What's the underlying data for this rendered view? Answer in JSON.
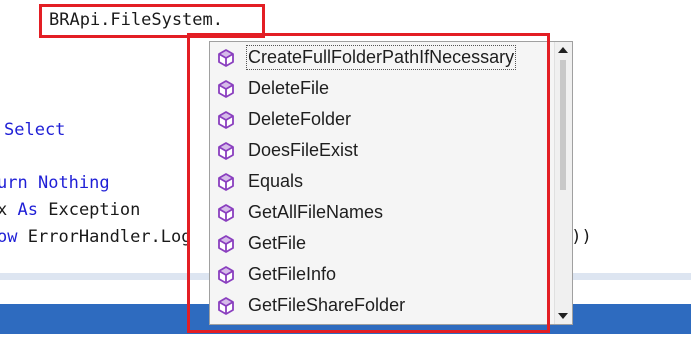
{
  "editor": {
    "typed_text": "BRApi.FileSystem.",
    "line_select_keyword": "Select",
    "line_return_partial": "urn",
    "line_return_value": "Nothing",
    "line_catch_var": "x",
    "line_catch_as": "As",
    "line_catch_type": "Exception",
    "line_throw_partial": "ow",
    "line_throw_call": "ErrorHandler.Log",
    "line_throw_tail": "x))"
  },
  "intellisense": {
    "selected_index": 0,
    "items": [
      {
        "label": "CreateFullFolderPathIfNecessary",
        "icon": "method-cube-icon"
      },
      {
        "label": "DeleteFile",
        "icon": "method-cube-icon"
      },
      {
        "label": "DeleteFolder",
        "icon": "method-cube-icon"
      },
      {
        "label": "DoesFileExist",
        "icon": "method-cube-icon"
      },
      {
        "label": "Equals",
        "icon": "method-cube-icon"
      },
      {
        "label": "GetAllFileNames",
        "icon": "method-cube-icon"
      },
      {
        "label": "GetFile",
        "icon": "method-cube-icon"
      },
      {
        "label": "GetFileInfo",
        "icon": "method-cube-icon"
      },
      {
        "label": "GetFileShareFolder",
        "icon": "method-cube-icon"
      }
    ],
    "icon_color": "#8a3fbf"
  },
  "colors": {
    "highlight_red": "#e31e24",
    "keyword_blue": "#1f1fd6",
    "status_blue": "#2e6bbf"
  }
}
